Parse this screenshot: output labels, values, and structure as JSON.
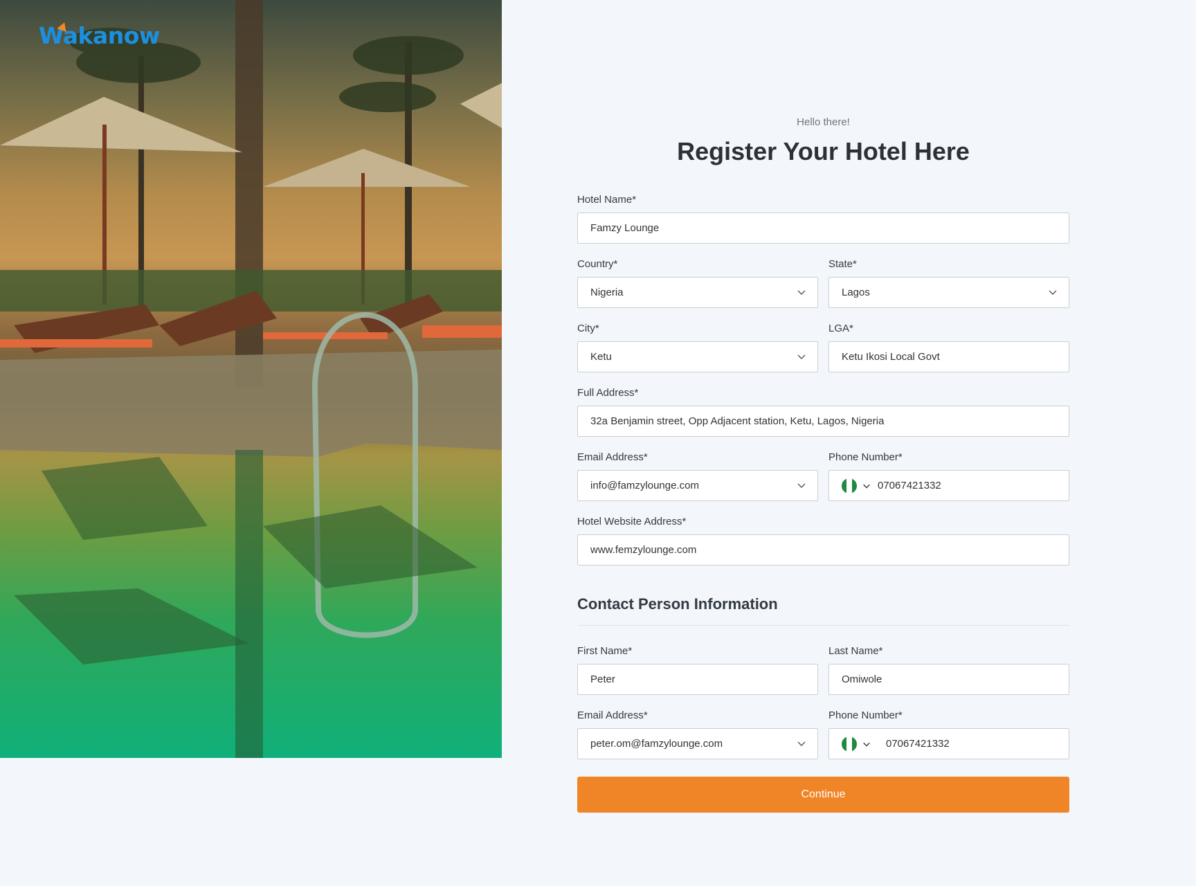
{
  "brand": {
    "logo_text": "Wakanow"
  },
  "header": {
    "greeting": "Hello there!",
    "title": "Register Your Hotel Here"
  },
  "hotel": {
    "name_label": "Hotel Name*",
    "name_value": "Famzy Lounge",
    "country_label": "Country*",
    "country_value": "Nigeria",
    "state_label": "State*",
    "state_value": "Lagos",
    "city_label": "City*",
    "city_value": "Ketu",
    "lga_label": "LGA*",
    "lga_value": "Ketu Ikosi Local Govt",
    "address_label": "Full Address*",
    "address_value": "32a Benjamin street, Opp Adjacent station, Ketu, Lagos, Nigeria",
    "email_label": "Email Address*",
    "email_value": "info@famzylounge.com",
    "phone_label": "Phone Number*",
    "phone_value": "07067421332",
    "website_label": "Hotel Website Address*",
    "website_value": "www.femzylounge.com"
  },
  "contact": {
    "section_title": "Contact Person Information",
    "first_label": "First Name*",
    "first_value": "Peter",
    "last_label": "Last Name*",
    "last_value": "Omiwole",
    "email_label": "Email Address*",
    "email_value": "peter.om@famzylounge.com",
    "phone_label": "Phone Number*",
    "phone_value": "07067421332"
  },
  "actions": {
    "continue_label": "Continue"
  },
  "colors": {
    "accent": "#f08527",
    "brand_blue": "#1c8fe0",
    "flag_green": "#1e8a3e"
  },
  "icons": {
    "dropdown": "chevron-down-icon",
    "flag": "nigeria-flag-icon"
  }
}
